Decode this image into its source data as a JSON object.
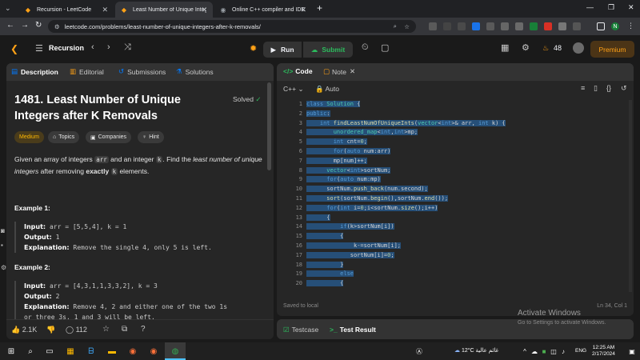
{
  "browser": {
    "tabs": [
      {
        "title": "Recursion - LeetCode"
      },
      {
        "title": "Least Number of Unique Integ..."
      },
      {
        "title": "Online C++ compiler and IDE"
      }
    ],
    "url": "leetcode.com/problems/least-number-of-unique-integers-after-k-removals/"
  },
  "topbar": {
    "list_name": "Recursion",
    "run_label": "Run",
    "submit_label": "Submit",
    "streak": "48",
    "premium_label": "Premium"
  },
  "description": {
    "tabs": [
      "Description",
      "Editorial",
      "Submissions",
      "Solutions"
    ],
    "title": "1481. Least Number of Unique Integers after K Removals",
    "status": "Solved",
    "chips": [
      "Medium",
      "Topics",
      "Companies",
      "Hint"
    ],
    "statement": {
      "p1": "Given an array of integers",
      "arr": "arr",
      "p2": "and an integer",
      "k": "k",
      "p3": ". Find the",
      "em": "least number of unique integers",
      "p4": "after removing",
      "exactly": "exactly",
      "p5": "elements."
    },
    "examples": [
      {
        "heading": "Example 1:",
        "input_label": "Input:",
        "input": "arr = [5,5,4], k = 1",
        "output_label": "Output:",
        "output": "1",
        "explanation_label": "Explanation:",
        "explanation": "Remove the single 4, only 5 is left."
      },
      {
        "heading": "Example 2:",
        "input_label": "Input:",
        "input": "arr = [4,3,1,1,3,3,2], k = 3",
        "output_label": "Output:",
        "output": "2",
        "explanation_label": "Explanation:",
        "explanation_l1": "Remove 4, 2 and either one of the two 1s",
        "explanation_l2": "or three 3s. 1 and 3 will be left."
      }
    ],
    "footer": {
      "likes": "2.1K",
      "comments": "112"
    }
  },
  "code": {
    "tabs": [
      "Code",
      "Note"
    ],
    "language": "C++",
    "mode": "Auto",
    "line_numbers": [
      "1",
      "2",
      "3",
      "4",
      "5",
      "6",
      "7",
      "8",
      "9",
      "10",
      "11",
      "12",
      "13",
      "14",
      "15",
      "16",
      "17",
      "18",
      "19",
      "20"
    ],
    "lines": [
      "class Solution {",
      "public:",
      "    int findLeastNumOfUniqueInts(vector<int>& arr, int k) {",
      "        unordered_map<int,int>mp;",
      "        int cnt=0;",
      "        for(auto num:arr)",
      "        mp[num]++;",
      "      vector<int>sortNum;",
      "      for(auto num:mp)",
      "      sortNum.push_back(num.second);",
      "      sort(sortNum.begin(),sortNum.end());",
      "      for(int i=0;i<sortNum.size();i++)",
      "      {",
      "          if(k>sortNum[i])",
      "          {",
      "              k-=sortNum[i];",
      "             sortNum[i]=0;",
      "          }",
      "          else",
      "          {"
    ],
    "saved_status": "Saved to local",
    "cursor": "Ln 34, Col 1"
  },
  "testpanel": {
    "testcase_label": "Testcase",
    "result_label": "Test Result"
  },
  "windows": {
    "watermark_title": "Activate Windows",
    "watermark_sub": "Go to Settings to activate Windows.",
    "weather": "12°C",
    "weather_text": "غائم عالية",
    "lang": "ENG",
    "time": "12:25 AM",
    "date": "2/17/2024"
  }
}
